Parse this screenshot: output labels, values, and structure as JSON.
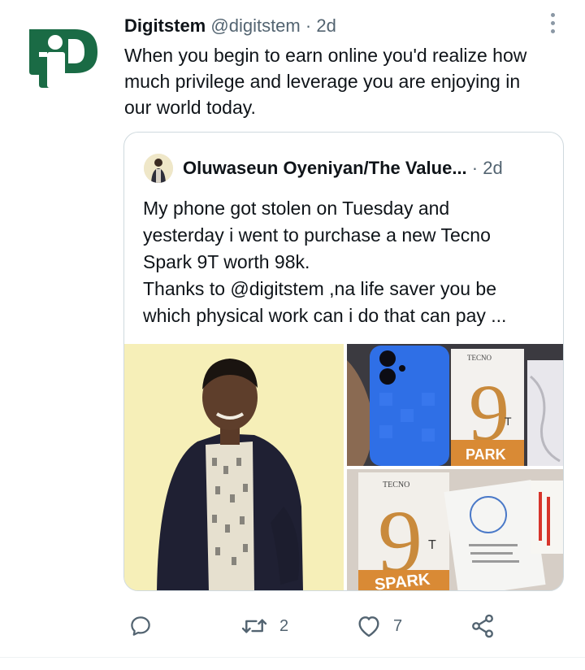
{
  "tweet": {
    "author_name": "Digitstem",
    "author_handle": "@digitstem",
    "separator": "·",
    "time": "2d",
    "text": "When you begin to earn online  you'd realize how\nmuch privilege and leverage you are  enjoying in\nour world today."
  },
  "quoted": {
    "author_name": "Oluwaseun Oyeniyan/The Value...",
    "separator": "·",
    "time": "2d",
    "text": "My phone got stolen on Tuesday and\nyesterday i went to purchase a new Tecno\nSpark 9T worth 98k.\nThanks to @digitstem ,na life saver you be\nwhich physical work can i do that can pay ..."
  },
  "media": {
    "phone_brand": "TECNO",
    "model_number": "9",
    "model_suffix": "T",
    "model_name_top": "PARK",
    "model_name_bottom": "SPARK"
  },
  "actions": {
    "reply_count": "",
    "retweet_count": "2",
    "like_count": "7"
  },
  "colors": {
    "brand_green": "#1a6b45",
    "secondary_text": "#536471",
    "border": "#cfd9de"
  },
  "icons": [
    "logo-icon",
    "more-icon",
    "reply-icon",
    "retweet-icon",
    "like-icon",
    "share-icon"
  ]
}
